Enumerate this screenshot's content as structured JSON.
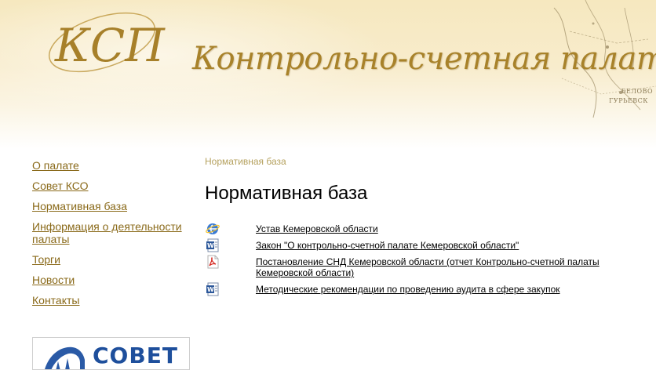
{
  "header": {
    "title": "Контрольно-счетная палата Кемеровской области",
    "logo_letters": "КСП",
    "map_labels": [
      "БЕЛОВО",
      "ГУРЬЕВСК"
    ]
  },
  "sidebar": {
    "items": [
      {
        "label": "О палате"
      },
      {
        "label": "Совет КСО"
      },
      {
        "label": "Нормативная база"
      },
      {
        "label": "Информация о деятельности палаты"
      },
      {
        "label": "Торги"
      },
      {
        "label": "Новости"
      },
      {
        "label": "Контакты"
      }
    ],
    "banner_text": "СОВЕТ"
  },
  "main": {
    "breadcrumb": "Нормативная база",
    "title": "Нормативная база",
    "documents": [
      {
        "icon": "ie-icon",
        "label": "Устав Кемеровской области"
      },
      {
        "icon": "word-icon",
        "label": "Закон \"О контрольно-счетной палате Кемеровской области\""
      },
      {
        "icon": "pdf-icon",
        "label": "Постановление СНД Кемеровской области (отчет Контрольно-счетной палаты Кемеровской области)"
      },
      {
        "icon": "word-icon",
        "label": "Методические рекомендации по проведению аудита в сфере закупок"
      }
    ]
  },
  "colors": {
    "header_bg": "#f6e8bf",
    "title_gold": "#a8822a",
    "nav_link": "#8a6a1a",
    "breadcrumb": "#b5a15e",
    "banner_blue": "#1e4f9c"
  }
}
